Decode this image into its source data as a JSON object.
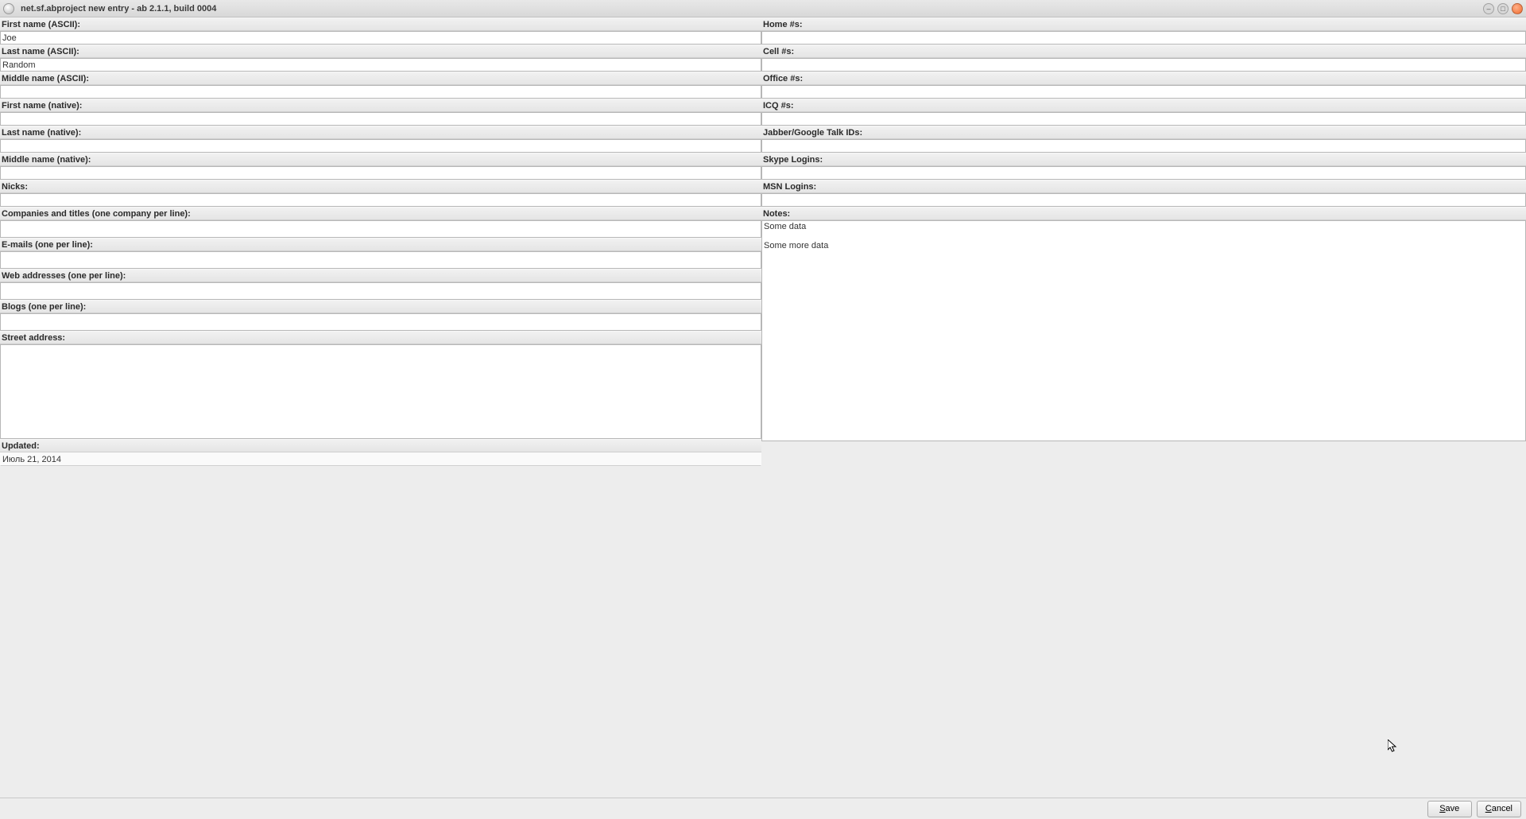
{
  "window": {
    "title": "net.sf.abproject new entry - ab 2.1.1, build 0004"
  },
  "left": {
    "first_name_ascii": {
      "label": "First name (ASCII):",
      "value": "Joe"
    },
    "last_name_ascii": {
      "label": "Last name (ASCII):",
      "value": "Random"
    },
    "middle_name_ascii": {
      "label": "Middle name (ASCII):",
      "value": ""
    },
    "first_name_native": {
      "label": "First name (native):",
      "value": ""
    },
    "last_name_native": {
      "label": "Last name (native):",
      "value": ""
    },
    "middle_name_native": {
      "label": "Middle name (native):",
      "value": ""
    },
    "nicks": {
      "label": "Nicks:",
      "value": ""
    },
    "companies": {
      "label": "Companies and titles (one company per line):",
      "value": ""
    },
    "emails": {
      "label": "E-mails (one per line):",
      "value": ""
    },
    "webs": {
      "label": "Web addresses (one per line):",
      "value": ""
    },
    "blogs": {
      "label": "Blogs (one per line):",
      "value": ""
    },
    "street": {
      "label": "Street address:",
      "value": ""
    },
    "updated": {
      "label": "Updated:",
      "value": "Июль 21, 2014"
    }
  },
  "right": {
    "home": {
      "label": "Home #s:",
      "value": ""
    },
    "cell": {
      "label": "Cell #s:",
      "value": ""
    },
    "office": {
      "label": "Office #s:",
      "value": ""
    },
    "icq": {
      "label": "ICQ #s:",
      "value": ""
    },
    "jabber": {
      "label": "Jabber/Google Talk IDs:",
      "value": ""
    },
    "skype": {
      "label": "Skype Logins:",
      "value": ""
    },
    "msn": {
      "label": "MSN Logins:",
      "value": ""
    },
    "notes": {
      "label": "Notes:",
      "value": "Some data\n\nSome more data"
    }
  },
  "buttons": {
    "save": "Save",
    "cancel": "Cancel"
  }
}
